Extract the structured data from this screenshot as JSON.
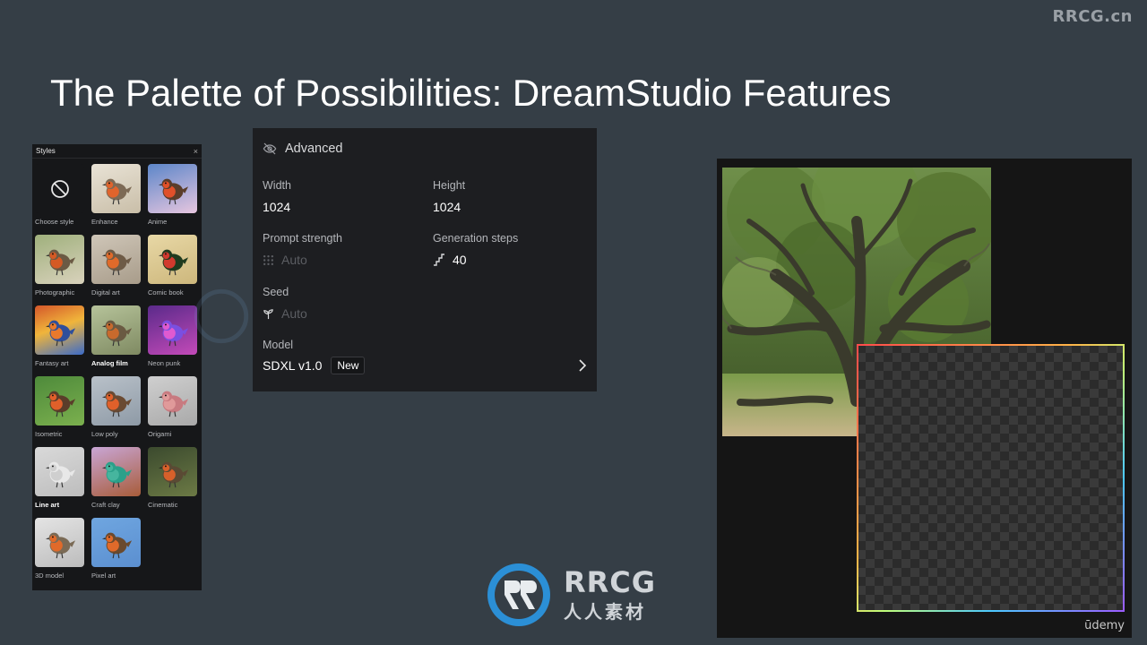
{
  "watermark_top": "RRCG.cn",
  "slide_title": "The Palette of Possibilities: DreamStudio Features",
  "styles_panel": {
    "title": "Styles",
    "close_glyph": "×",
    "items": [
      {
        "label": "Choose style",
        "thumb": "none"
      },
      {
        "label": "Enhance",
        "thumb": "enhance"
      },
      {
        "label": "Anime",
        "thumb": "anime"
      },
      {
        "label": "Photographic",
        "thumb": "photographic"
      },
      {
        "label": "Digital art",
        "thumb": "digital"
      },
      {
        "label": "Comic book",
        "thumb": "comic"
      },
      {
        "label": "Fantasy art",
        "thumb": "fantasy"
      },
      {
        "label": "Analog film",
        "thumb": "analog",
        "selected": true
      },
      {
        "label": "Neon punk",
        "thumb": "neon"
      },
      {
        "label": "Isometric",
        "thumb": "isometric"
      },
      {
        "label": "Low poly",
        "thumb": "lowpoly"
      },
      {
        "label": "Origami",
        "thumb": "origami"
      },
      {
        "label": "Line art",
        "thumb": "lineart",
        "selected": true
      },
      {
        "label": "Craft clay",
        "thumb": "clay"
      },
      {
        "label": "Cinematic",
        "thumb": "cinematic"
      },
      {
        "label": "3D model",
        "thumb": "model3d"
      },
      {
        "label": "Pixel art",
        "thumb": "pixel"
      }
    ]
  },
  "advanced_panel": {
    "header": "Advanced",
    "width_label": "Width",
    "width_value": "1024",
    "height_label": "Height",
    "height_value": "1024",
    "prompt_strength_label": "Prompt strength",
    "prompt_strength_value": "Auto",
    "generation_steps_label": "Generation steps",
    "generation_steps_value": "40",
    "seed_label": "Seed",
    "seed_value": "Auto",
    "model_label": "Model",
    "model_value": "SDXL v1.0",
    "model_badge": "New"
  },
  "canvas": {
    "brand": "ūdemy"
  },
  "logo": {
    "top_text": "RRCG",
    "bottom_text": "人人素材"
  }
}
